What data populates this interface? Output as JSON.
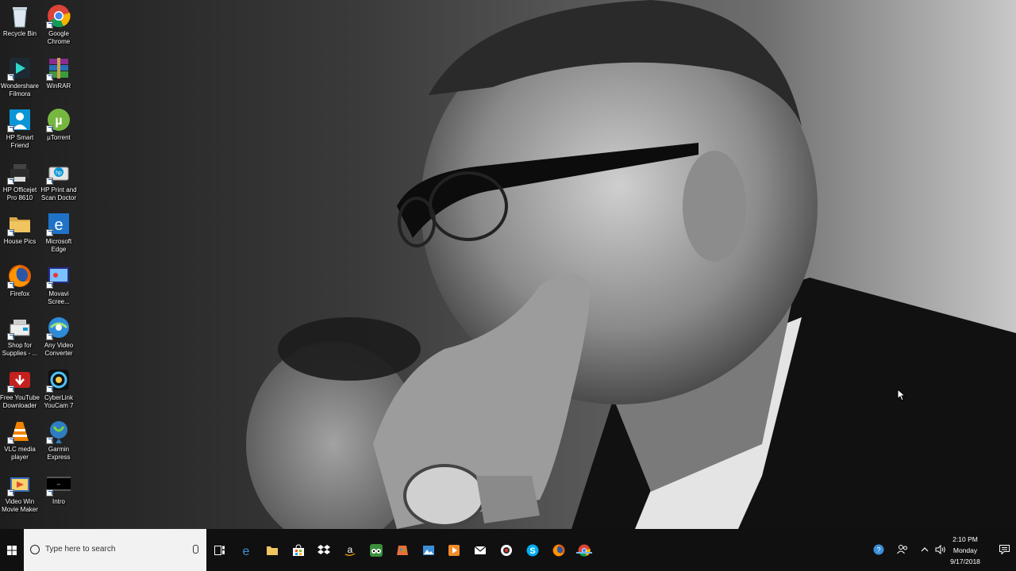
{
  "desktop": {
    "icons": [
      {
        "label": "Recycle Bin",
        "icon": "recycle-bin-icon"
      },
      {
        "label": "Google\nChrome",
        "icon": "chrome-icon"
      },
      {
        "label": "Wondershare\nFilmora",
        "icon": "filmora-icon"
      },
      {
        "label": "WinRAR",
        "icon": "winrar-icon"
      },
      {
        "label": "HP Smart\nFriend",
        "icon": "hp-smart-friend-icon"
      },
      {
        "label": "µTorrent",
        "icon": "utorrent-icon"
      },
      {
        "label": "HP Officejet\nPro 8610",
        "icon": "printer-icon"
      },
      {
        "label": "HP Print and\nScan Doctor",
        "icon": "hp-print-scan-icon"
      },
      {
        "label": "House Pics",
        "icon": "folder-icon"
      },
      {
        "label": "Microsoft\nEdge",
        "icon": "edge-icon"
      },
      {
        "label": "Firefox",
        "icon": "firefox-icon"
      },
      {
        "label": "Movavi\nScree...",
        "icon": "movavi-icon"
      },
      {
        "label": "Shop for\nSupplies - ...",
        "icon": "shop-supplies-icon"
      },
      {
        "label": "Any Video\nConverter",
        "icon": "any-video-converter-icon"
      },
      {
        "label": "Free YouTube\nDownloader",
        "icon": "youtube-downloader-icon"
      },
      {
        "label": "CyberLink\nYouCam 7",
        "icon": "youcam-icon"
      },
      {
        "label": "VLC media\nplayer",
        "icon": "vlc-icon"
      },
      {
        "label": "Garmin\nExpress",
        "icon": "garmin-icon"
      },
      {
        "label": "Video Win\nMovie Maker",
        "icon": "movie-maker-icon"
      },
      {
        "label": "Intro",
        "icon": "video-file-icon"
      }
    ]
  },
  "taskbar": {
    "search_placeholder": "Type here to search",
    "apps": [
      {
        "name": "edge",
        "icon": "edge-icon"
      },
      {
        "name": "file-explorer",
        "icon": "folder-icon"
      },
      {
        "name": "store",
        "icon": "store-icon"
      },
      {
        "name": "dropbox",
        "icon": "dropbox-icon"
      },
      {
        "name": "amazon",
        "icon": "amazon-icon"
      },
      {
        "name": "tripadvisor",
        "icon": "tripadvisor-icon"
      },
      {
        "name": "paint",
        "icon": "paint-icon"
      },
      {
        "name": "photos",
        "icon": "photos-icon"
      },
      {
        "name": "media-player",
        "icon": "media-player-icon"
      },
      {
        "name": "mail",
        "icon": "mail-icon"
      },
      {
        "name": "webcam",
        "icon": "webcam-icon"
      },
      {
        "name": "skype",
        "icon": "skype-icon"
      },
      {
        "name": "firefox",
        "icon": "firefox-icon"
      },
      {
        "name": "chrome",
        "icon": "chrome-icon"
      }
    ],
    "clock": {
      "time": "2:10 PM",
      "day": "Monday",
      "date": "9/17/2018"
    }
  },
  "colors": {
    "taskbar_bg": "#101010",
    "search_bg": "#f2f2f2",
    "active_indicator": "#76b9ed"
  }
}
